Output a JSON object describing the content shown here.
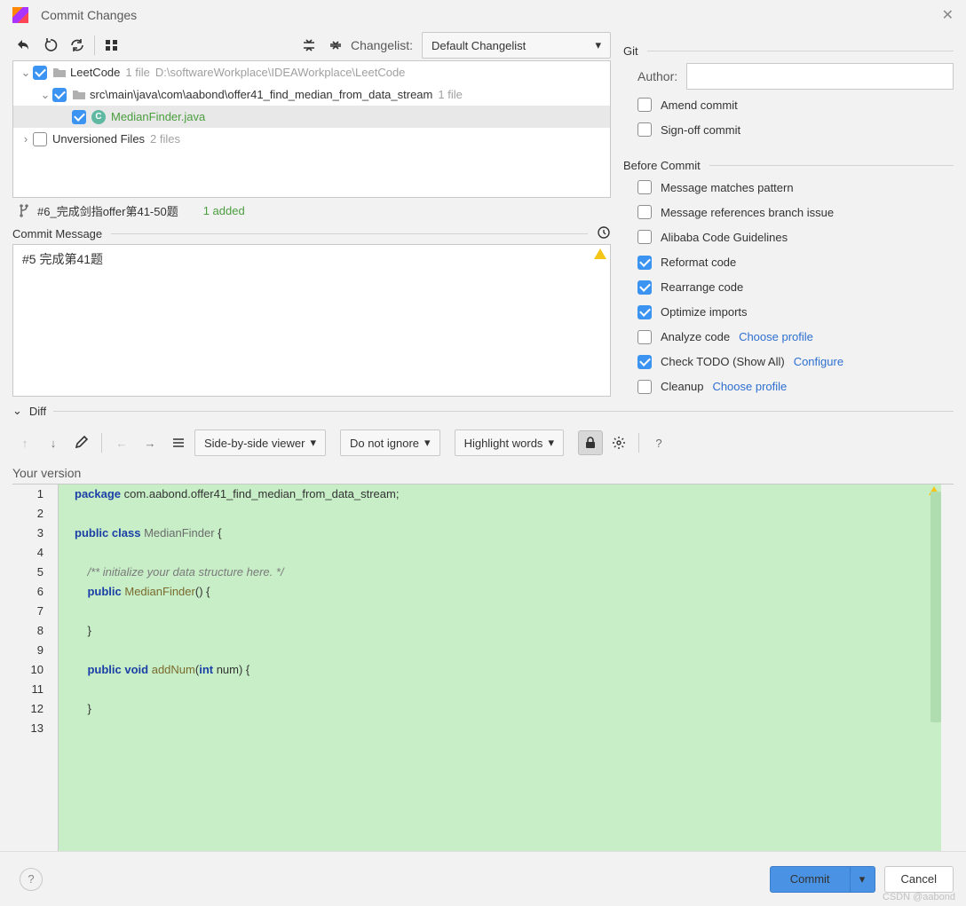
{
  "window": {
    "title": "Commit Changes"
  },
  "toolbar": {
    "changelist_label": "Changelist:",
    "changelist_value": "Default Changelist"
  },
  "tree": {
    "r0": {
      "name": "LeetCode",
      "meta1": "1 file",
      "meta2": "D:\\softwareWorkplace\\IDEAWorkplace\\LeetCode"
    },
    "r1": {
      "name": "src\\main\\java\\com\\aabond\\offer41_find_median_from_data_stream",
      "meta1": "1 file"
    },
    "r2": {
      "name": "MedianFinder.java"
    },
    "r3": {
      "name": "Unversioned Files",
      "meta1": "2 files"
    }
  },
  "branch": {
    "name": "#6_完成剑指offer第41-50题",
    "added": "1 added"
  },
  "commitMsg": {
    "label": "Commit Message",
    "value": "#5 完成第41题"
  },
  "git": {
    "section": "Git",
    "author_label": "Author:",
    "author_value": "",
    "amend": "Amend commit",
    "signoff": "Sign-off commit"
  },
  "before": {
    "section": "Before Commit",
    "pattern": "Message matches pattern",
    "branchIssue": "Message references branch issue",
    "alibaba": "Alibaba Code Guidelines",
    "reformat": "Reformat code",
    "rearrange": "Rearrange code",
    "optimize": "Optimize imports",
    "analyze": "Analyze code",
    "analyze_link": "Choose profile",
    "todo": "Check TODO (Show All)",
    "todo_link": "Configure",
    "cleanup": "Cleanup",
    "cleanup_link": "Choose profile"
  },
  "diff": {
    "section": "Diff",
    "viewer": "Side-by-side viewer",
    "ignore": "Do not ignore",
    "highlight": "Highlight words",
    "version": "Your version"
  },
  "code": {
    "l1": "package com.aabond.offer41_find_median_from_data_stream;",
    "l3a": "public",
    "l3b": "class",
    "l3c": "MedianFinder {",
    "l5": "/** initialize your data structure here. */",
    "l6a": "public",
    "l6b": "MedianFinder() {",
    "l8": "}",
    "l10a": "public",
    "l10b": "void",
    "l10c": "addNum(",
    "l10d": "int",
    "l10e": " num) {",
    "l12": "}"
  },
  "footer": {
    "commit": "Commit",
    "cancel": "Cancel"
  },
  "watermark": "CSDN @aabond"
}
